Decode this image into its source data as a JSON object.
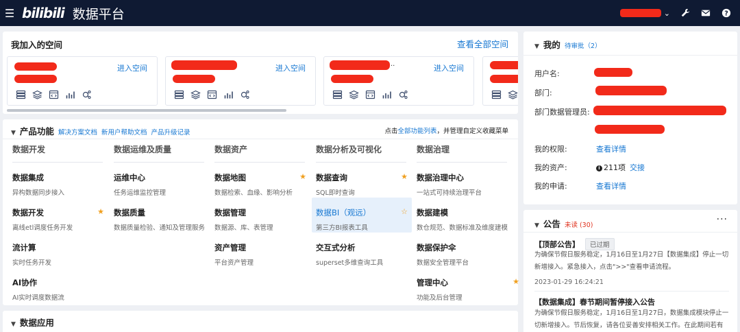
{
  "topbar": {
    "logo": "bilibili",
    "title": "数据平台",
    "menu_caret": "⌄"
  },
  "spaces": {
    "title": "我加入的空间",
    "view_all": "查看全部空间",
    "enter_label": "进入空间",
    "cards": [
      {
        "name_suffix": ""
      },
      {
        "name_suffix": ""
      },
      {
        "name_suffix": ".."
      },
      {
        "name_suffix": ""
      }
    ]
  },
  "products": {
    "title": "产品功能",
    "links": [
      "解决方案文档",
      "新用户帮助文档",
      "产品升级记录"
    ],
    "note_prefix": "点击",
    "note_link": "全部功能列表",
    "note_suffix": "，并管理自定义收藏菜单",
    "columns": [
      {
        "title": "数据开发",
        "items": [
          {
            "title": "数据集成",
            "desc": "异构数据同步接入",
            "star": false
          },
          {
            "title": "数据开发",
            "desc": "离线etl调度任务开发",
            "star": true
          },
          {
            "title": "流计算",
            "desc": "实时任务开发",
            "star": false
          },
          {
            "title": "AI协作",
            "desc": "AI实时调度数据流",
            "star": false
          }
        ]
      },
      {
        "title": "数据运维及质量",
        "items": [
          {
            "title": "运维中心",
            "desc": "任务运维监控管理",
            "star": false
          },
          {
            "title": "数据质量",
            "desc": "数据质量检验、通知及管理服务",
            "star": false
          }
        ]
      },
      {
        "title": "数据资产",
        "items": [
          {
            "title": "数据地图",
            "desc": "数据检索、血缘、影响分析",
            "star": true
          },
          {
            "title": "数据管理",
            "desc": "数据源、库、表管理",
            "star": false
          },
          {
            "title": "资产管理",
            "desc": "平台资产管理",
            "star": false
          }
        ]
      },
      {
        "title": "数据分析及可视化",
        "items": [
          {
            "title": "数据查询",
            "desc": "SQL即时查询",
            "star": true
          },
          {
            "title": "数据BI（观远）",
            "desc": "第三方BI报表工具",
            "star": true,
            "highlight": true,
            "outline": true
          },
          {
            "title": "交互式分析",
            "desc": "superset多维查询工具",
            "star": false
          }
        ]
      },
      {
        "title": "数据治理",
        "items": [
          {
            "title": "数据治理中心",
            "desc": "一站式可持续治理平台",
            "star": false
          },
          {
            "title": "数据建模",
            "desc": "数仓规范、数据标准及维度建模",
            "star": false
          },
          {
            "title": "数据保护伞",
            "desc": "数据安全管理平台",
            "star": false
          },
          {
            "title": "管理中心",
            "desc": "功能及后台管理",
            "star": true
          }
        ]
      }
    ]
  },
  "apps": {
    "title": "数据应用"
  },
  "mine": {
    "title": "我的",
    "pending": "待审批（2）",
    "labels": [
      "用户名:",
      "部门:",
      "部门数据管理员:",
      "我的权限:",
      "我的资产:",
      "我的申请:"
    ],
    "view_details": "查看详情",
    "assets_count": "211项",
    "assets_info_icon": "i",
    "assets_accept": "交接"
  },
  "announcements": {
    "title": "公告",
    "unread": "未读 (30)",
    "more": "···",
    "items": [
      {
        "title": "【顶部公告】",
        "badge": "已过期",
        "body": "为确保节假日服务稳定，1月16日至1月27日【数据集成】停止一切新增接入。紧急接入，点击\">>\"查看申请流程。",
        "date": "2023-01-29 16:24:21"
      },
      {
        "title": "【数据集成】春节期间暂停接入公告",
        "body": "为确保节假日服务稳定，1月16日至1月27日，数据集成模块停止一切新增接入。节后恢复，请各位妥善安排相关工作。在此期间若有紧急"
      }
    ]
  }
}
